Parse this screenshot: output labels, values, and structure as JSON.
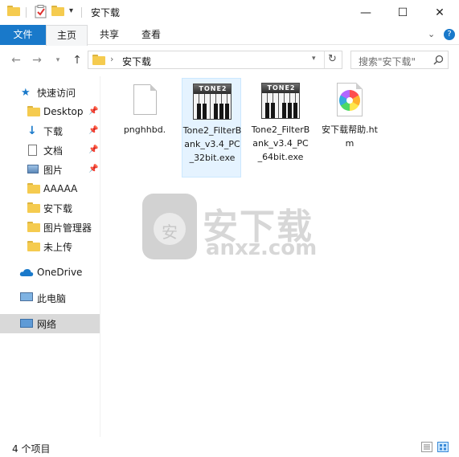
{
  "window": {
    "title": "安下载",
    "minimize_glyph": "—",
    "maximize_glyph": "☐",
    "close_glyph": "✕"
  },
  "ribbon": {
    "tabs": [
      {
        "label": "文件"
      },
      {
        "label": "主页"
      },
      {
        "label": "共享"
      },
      {
        "label": "查看"
      }
    ],
    "collapse_glyph": "⌄",
    "help_glyph": "?"
  },
  "address": {
    "path": "安下载",
    "search_placeholder": "搜索\"安下载\""
  },
  "sidebar": {
    "items": [
      {
        "label": "快速访问",
        "icon": "star-icon"
      },
      {
        "label": "Desktop",
        "icon": "folder-icon",
        "pinned": true
      },
      {
        "label": "下载",
        "icon": "download-arrow-icon",
        "pinned": true
      },
      {
        "label": "文档",
        "icon": "document-icon",
        "pinned": true
      },
      {
        "label": "图片",
        "icon": "picture-icon",
        "pinned": true
      },
      {
        "label": "AAAAA",
        "icon": "folder-icon"
      },
      {
        "label": "安下载",
        "icon": "folder-icon"
      },
      {
        "label": "图片管理器",
        "icon": "folder-icon"
      },
      {
        "label": "未上传",
        "icon": "folder-icon"
      },
      {
        "label": "OneDrive",
        "icon": "cloud-icon"
      },
      {
        "label": "此电脑",
        "icon": "computer-icon"
      },
      {
        "label": "网络",
        "icon": "network-icon",
        "selected": true
      }
    ]
  },
  "files": [
    {
      "name": "pnghhbd.",
      "icon": "blank-file-icon"
    },
    {
      "name": "Tone2_FilterBank_v3.4_PC_32bit.exe",
      "icon": "tone2-app-icon",
      "selected": true
    },
    {
      "name": "Tone2_FilterBank_v3.4_PC_64bit.exe",
      "icon": "tone2-app-icon"
    },
    {
      "name": "安下载帮助.htm",
      "icon": "chrome-html-icon"
    }
  ],
  "watermark": {
    "text": "安下载",
    "url": "anxz.com",
    "badge_glyph": "安"
  },
  "tone2_logo": "TONE2",
  "status": {
    "item_count": "4 个项目"
  },
  "colors": {
    "accent": "#1979ca",
    "selection": "#cce8ff",
    "folder": "#f5cb4f"
  }
}
